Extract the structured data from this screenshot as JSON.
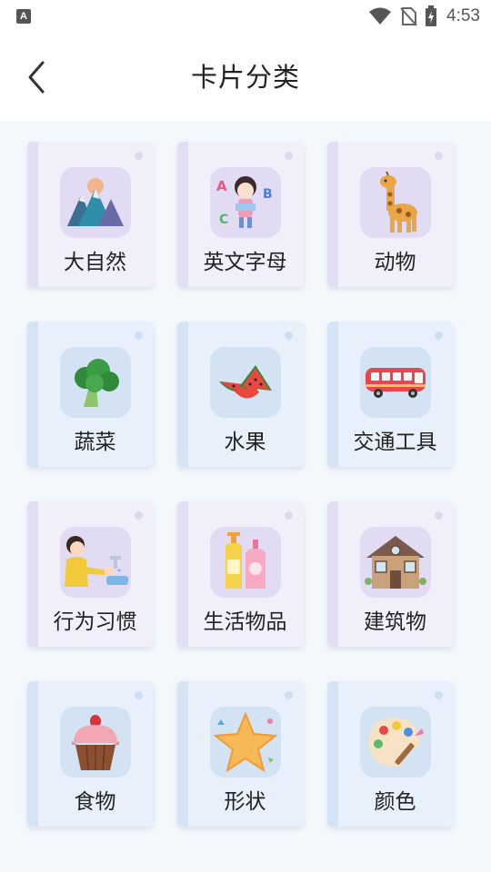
{
  "status_bar": {
    "notification_icon_letter": "A",
    "time": "4:53"
  },
  "header": {
    "title": "卡片分类",
    "back_icon": "chevron-left-icon"
  },
  "categories": [
    {
      "label": "大自然",
      "icon": "mountain-icon",
      "theme": "purple"
    },
    {
      "label": "英文字母",
      "icon": "girl-letters-icon",
      "theme": "purple"
    },
    {
      "label": "动物",
      "icon": "giraffe-icon",
      "theme": "purple"
    },
    {
      "label": "蔬菜",
      "icon": "broccoli-icon",
      "theme": "blue"
    },
    {
      "label": "水果",
      "icon": "watermelon-icon",
      "theme": "blue"
    },
    {
      "label": "交通工具",
      "icon": "bus-icon",
      "theme": "blue"
    },
    {
      "label": "行为习惯",
      "icon": "handwashing-icon",
      "theme": "purple"
    },
    {
      "label": "生活物品",
      "icon": "lotion-bottles-icon",
      "theme": "purple"
    },
    {
      "label": "建筑物",
      "icon": "house-icon",
      "theme": "purple"
    },
    {
      "label": "食物",
      "icon": "cupcake-icon",
      "theme": "blue"
    },
    {
      "label": "形状",
      "icon": "star-icon",
      "theme": "blue"
    },
    {
      "label": "颜色",
      "icon": "palette-icon",
      "theme": "blue"
    }
  ]
}
